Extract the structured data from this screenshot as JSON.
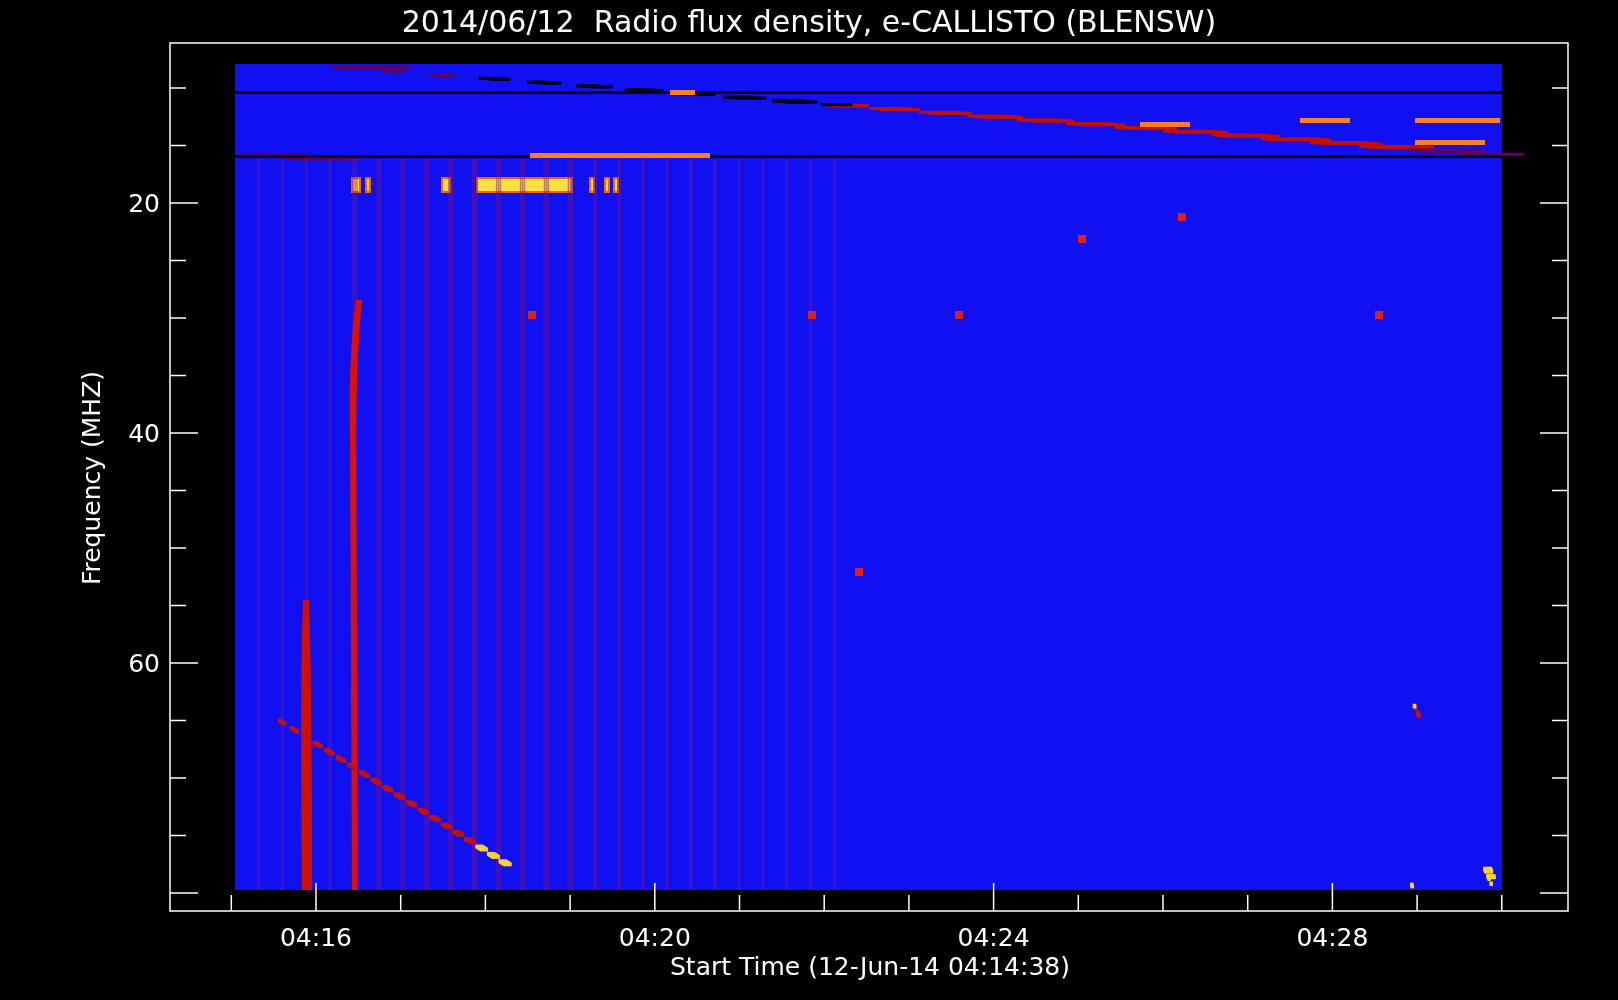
{
  "title": "2014/06/12  Radio flux density, e-CALLISTO (BLENSW)",
  "y_axis": {
    "label": "Frequency (MHZ)",
    "tick_labels": [
      "20",
      "40",
      "60"
    ]
  },
  "x_axis": {
    "label": "Start Time (12-Jun-14 04:14:38)",
    "tick_labels": [
      "04:16",
      "04:20",
      "04:24",
      "04:28"
    ]
  }
}
